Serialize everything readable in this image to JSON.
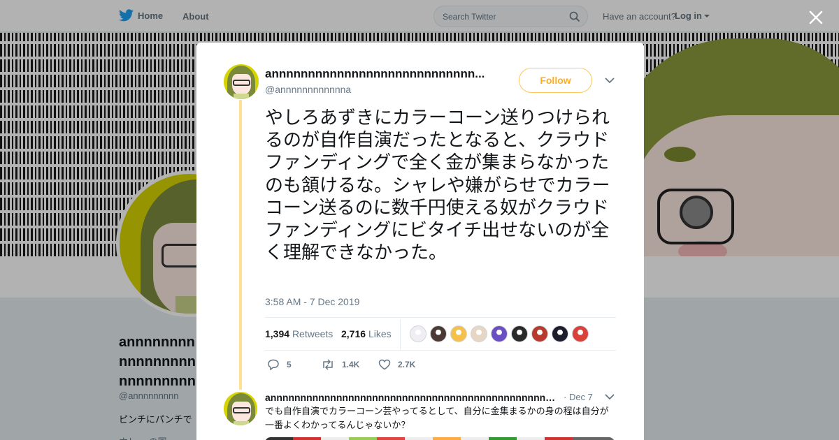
{
  "nav": {
    "home_label": "Home",
    "about_label": "About",
    "search_placeholder": "Search Twitter",
    "account_prompt": "Have an account?",
    "login_label": "Log in"
  },
  "profile": {
    "name_line1": "annnnnnnn",
    "name_line2": "nnnnnnnnn",
    "name_line3": "nnnnnnnnn",
    "handle": "@annnnnnnnn",
    "bio": "ピンチにパンチで",
    "location": "ホレー の国"
  },
  "tweet": {
    "author_name": "annnnnnnnnnnnnnnnnnnnnnnnnnnn...",
    "author_handle": "@annnnnnnnnnnna",
    "follow_label": "Follow",
    "text": "やしろあずきにカラーコーン送りつけられるのが自作自演だったとなると、クラウドファンディングで全く金が集まらなかったのも頷けるな。シャレや嫌がらせでカラーコーン送るのに数千円使える奴がクラウドファンディングにビタイチ出せないのが全く理解できなかった。",
    "timestamp": "3:58 AM - 7 Dec 2019",
    "retweet_count": "1,394",
    "retweet_label": "Retweets",
    "like_count": "2,716",
    "like_label": "Likes",
    "reply_action_count": "5",
    "retweet_action_count": "1.4K",
    "like_action_count": "2.7K"
  },
  "liker_avatars": [
    {
      "icon": "liker-avatar-1",
      "color": "#f0eef3"
    },
    {
      "icon": "liker-avatar-2",
      "color": "#4b3a33"
    },
    {
      "icon": "liker-avatar-3",
      "color": "#f6c14a"
    },
    {
      "icon": "liker-avatar-4",
      "color": "#e8d6c5"
    },
    {
      "icon": "liker-avatar-5",
      "color": "#6a4ec2"
    },
    {
      "icon": "liker-avatar-6",
      "color": "#2a2a2a"
    },
    {
      "icon": "liker-avatar-7",
      "color": "#b83a2d"
    },
    {
      "icon": "liker-avatar-8",
      "color": "#1d1d2b"
    },
    {
      "icon": "liker-avatar-9",
      "color": "#d9413a"
    }
  ],
  "reply": {
    "author_name": "annnnnnnnnnnnnnnnnnnnnnnnnnnnnnnnnnnnnnnnnnnnnnnn...",
    "date": "· Dec 7",
    "text": "でも自作自演でカラーコーン芸やってるとして、自分に金集まるかの身の程は自分が一番よくわかってるんじゃないか？"
  },
  "colors": {
    "brand_blue": "#1da1f2",
    "follow_accent": "#ffad1f",
    "thread_line": "#ffe28f",
    "secondary_text": "#657786"
  }
}
